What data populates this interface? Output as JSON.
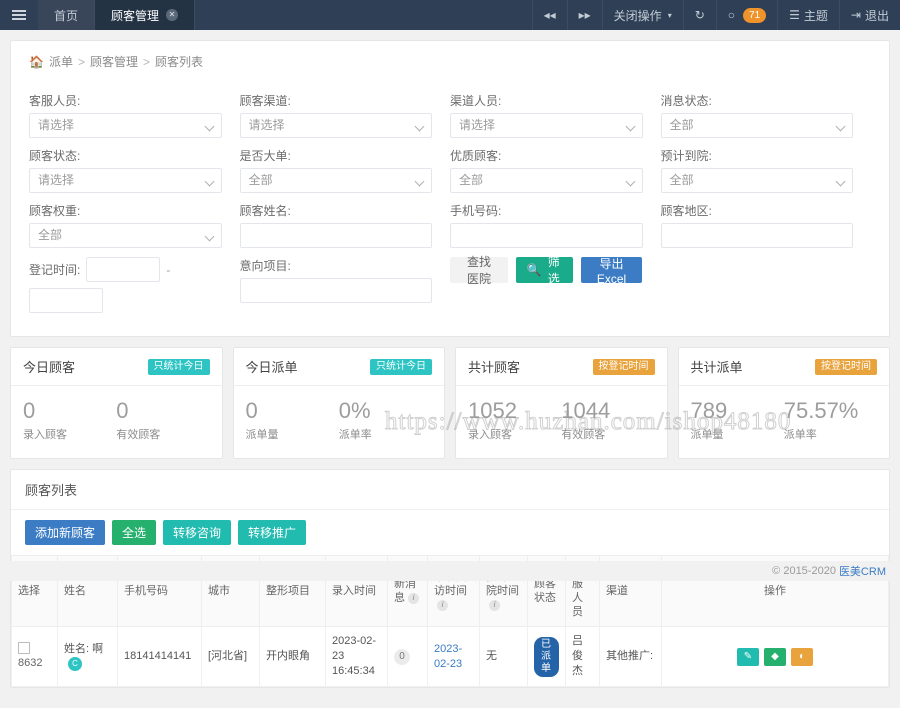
{
  "topbar": {
    "menu_icon": "hamburger-icon",
    "tabs": [
      {
        "label": "首页",
        "active": false,
        "closable": false
      },
      {
        "label": "顾客管理",
        "active": true,
        "closable": true
      }
    ],
    "right_items": [
      {
        "name": "prev-tabs",
        "icon": "double-left-icon",
        "label": "◂◂"
      },
      {
        "name": "next-tabs",
        "icon": "double-right-icon",
        "label": "▸▸"
      },
      {
        "name": "close-operations",
        "label": "关闭操作",
        "caret": "▾"
      },
      {
        "name": "refresh",
        "icon": "refresh-icon",
        "label": "↻"
      },
      {
        "name": "messages",
        "icon": "chat-icon",
        "label": "○",
        "badge": "71"
      },
      {
        "name": "theme",
        "icon": "theme-icon",
        "label": "主题"
      },
      {
        "name": "logout",
        "icon": "logout-icon",
        "label": "退出"
      }
    ]
  },
  "breadcrumb": {
    "home_icon": "home-icon",
    "items": [
      "派单",
      "顾客管理",
      "顾客列表"
    ],
    "separator": ">"
  },
  "filter": {
    "columns": [
      {
        "fields": [
          {
            "label": "客服人员:",
            "type": "select",
            "value": "请选择",
            "name": "service-staff"
          },
          {
            "label": "顾客状态:",
            "type": "select",
            "value": "请选择",
            "name": "customer-status"
          },
          {
            "label": "顾客权重:",
            "type": "select",
            "value": "全部",
            "name": "customer-weight"
          },
          {
            "label": "登记时间:",
            "type": "daterange",
            "value": "",
            "value2": "",
            "dash": "-",
            "name": "register-time"
          }
        ]
      },
      {
        "fields": [
          {
            "label": "顾客渠道:",
            "type": "select",
            "value": "请选择",
            "name": "customer-channel"
          },
          {
            "label": "是否大单:",
            "type": "select",
            "value": "全部",
            "name": "is-big-order"
          },
          {
            "label": "顾客姓名:",
            "type": "text",
            "value": "",
            "name": "customer-name"
          },
          {
            "label": "意向项目:",
            "type": "text",
            "value": "",
            "name": "intent-project"
          }
        ]
      },
      {
        "fields": [
          {
            "label": "渠道人员:",
            "type": "select",
            "value": "请选择",
            "name": "channel-staff"
          },
          {
            "label": "优质顾客:",
            "type": "select",
            "value": "全部",
            "name": "quality-customer"
          },
          {
            "label": "手机号码:",
            "type": "text",
            "value": "",
            "name": "phone-number"
          }
        ],
        "buttons": [
          {
            "label": "查找医院",
            "style": "grey",
            "name": "find-hospital-button"
          },
          {
            "label": "筛 选",
            "style": "green",
            "icon": "search-icon",
            "name": "filter-button"
          },
          {
            "label": "导出Excel",
            "style": "blue",
            "name": "export-excel-button"
          }
        ]
      },
      {
        "fields": [
          {
            "label": "消息状态:",
            "type": "select",
            "value": "全部",
            "name": "message-status"
          },
          {
            "label": "预计到院:",
            "type": "select",
            "value": "全部",
            "name": "expected-arrival"
          },
          {
            "label": "顾客地区:",
            "type": "text",
            "value": "",
            "name": "customer-region"
          }
        ]
      }
    ]
  },
  "stats": [
    {
      "title": "今日顾客",
      "tag": "只统计今日",
      "tag_color": "#2ec4c4",
      "cells": [
        {
          "value": "0",
          "label": "录入顾客"
        },
        {
          "value": "0",
          "label": "有效顾客"
        }
      ]
    },
    {
      "title": "今日派单",
      "tag": "只统计今日",
      "tag_color": "#2ec4c4",
      "cells": [
        {
          "value": "0",
          "label": "派单量"
        },
        {
          "value": "0%",
          "label": "派单率"
        }
      ]
    },
    {
      "title": "共计顾客",
      "tag": "按登记时间",
      "tag_color": "#e8a33d",
      "cells": [
        {
          "value": "1052",
          "label": "录入顾客"
        },
        {
          "value": "1044",
          "label": "有效顾客"
        }
      ]
    },
    {
      "title": "共计派单",
      "tag": "按登记时间",
      "tag_color": "#e8a33d",
      "cells": [
        {
          "value": "789",
          "label": "派单量"
        },
        {
          "value": "75.57%",
          "label": "派单率"
        }
      ]
    }
  ],
  "list": {
    "title": "顾客列表",
    "tools": [
      {
        "label": "添加新顾客",
        "style": "b1",
        "name": "add-customer-button"
      },
      {
        "label": "全选",
        "style": "b2",
        "name": "select-all-button"
      },
      {
        "label": "转移咨询",
        "style": "b3",
        "name": "transfer-consult-button"
      },
      {
        "label": "转移推广",
        "style": "b4",
        "name": "transfer-promote-button"
      }
    ],
    "columns": [
      {
        "label": "选择",
        "info": false
      },
      {
        "label": "姓名",
        "info": false
      },
      {
        "label": "手机号码",
        "info": false
      },
      {
        "label": "城市",
        "info": false
      },
      {
        "label": "整形项目",
        "info": false
      },
      {
        "label": "录入时间",
        "info": false
      },
      {
        "label": "新消息",
        "info": true
      },
      {
        "label": "下次回访时间",
        "info": true
      },
      {
        "label": "预计到院时间",
        "info": true
      },
      {
        "label": "顾客状态",
        "info": false
      },
      {
        "label": "客服人员",
        "info": false
      },
      {
        "label": "渠道",
        "info": false
      },
      {
        "label": "操作",
        "info": false
      }
    ],
    "rows": [
      {
        "id": "8632",
        "checked": false,
        "name_prefix": "姓名:",
        "name": "啊",
        "name_badge": "C",
        "phone": "18141414141",
        "city": "[河北省]",
        "project": "开内眼角",
        "entry_time": "2023-02-23 16:45:34",
        "new_messages": "0",
        "next_visit": "2023-02-23",
        "expected_arrival": "无",
        "status": "已派单",
        "staff": "吕俊杰",
        "channel": "其他推广:",
        "actions": [
          {
            "name": "edit-action",
            "icon": "edit-icon",
            "glyph": "✎",
            "style": "a1"
          },
          {
            "name": "tag-action",
            "icon": "tag-icon",
            "glyph": "◆",
            "style": "a2"
          },
          {
            "name": "status-action",
            "icon": "contrast-icon",
            "glyph": "◐",
            "style": "a3"
          }
        ]
      }
    ]
  },
  "watermark": "https://www.huzhan.com/ishop48180",
  "footer": {
    "copyright": "© 2015-2020",
    "brand": "医美CRM"
  }
}
